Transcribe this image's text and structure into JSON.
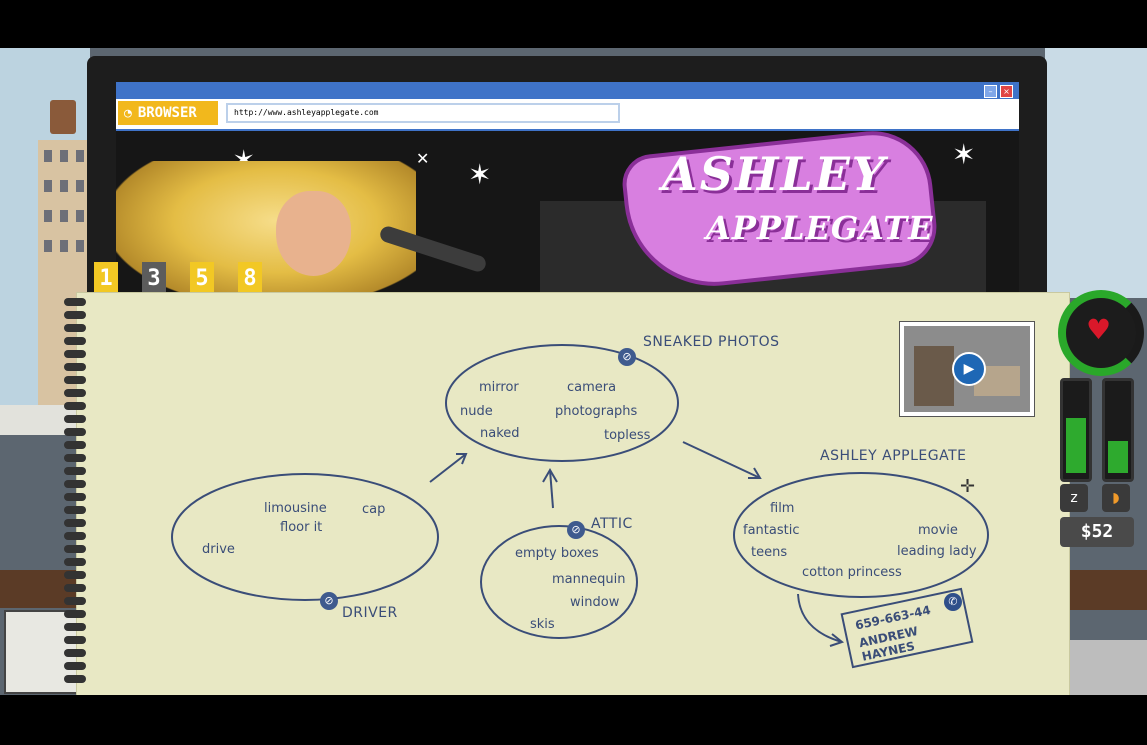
{
  "browser": {
    "title": "BROWSER",
    "url": "http://www.ashleyapplegate.com",
    "page": {
      "logo_line1": "ASHLEY",
      "logo_line2": "APPLEGATE"
    }
  },
  "tabs": [
    {
      "label": "1",
      "color": "#f2c824"
    },
    {
      "label": "3",
      "color": "#5c5c5c"
    },
    {
      "label": "5",
      "color": "#f2c824"
    },
    {
      "label": "8",
      "color": "#f2c824"
    }
  ],
  "notebook": {
    "groups": {
      "sneaked_photos": {
        "title": "SNEAKED PHOTOS",
        "words": [
          "mirror",
          "camera",
          "nude",
          "photographs",
          "naked",
          "topless"
        ]
      },
      "ashley_applegate": {
        "title": "ASHLEY APPLEGATE",
        "words": [
          "film",
          "fantastic",
          "movie",
          "teens",
          "leading lady",
          "cotton princess"
        ]
      },
      "driver": {
        "title": "DRIVER",
        "words": [
          "limousine",
          "cap",
          "floor it",
          "drive"
        ]
      },
      "attic": {
        "title": "ATTIC",
        "words": [
          "empty boxes",
          "mannequin",
          "window",
          "skis"
        ]
      }
    },
    "contact": {
      "phone": "659-663-44",
      "name": "ANDREW HAYNES"
    }
  },
  "hud": {
    "money": "$52",
    "sleep_level": 0.6,
    "hunger_level": 0.35,
    "health_level": 0.8,
    "icons": {
      "heart": "heart-icon",
      "sleep": "sleep-icon",
      "food": "chicken-leg-icon"
    }
  }
}
